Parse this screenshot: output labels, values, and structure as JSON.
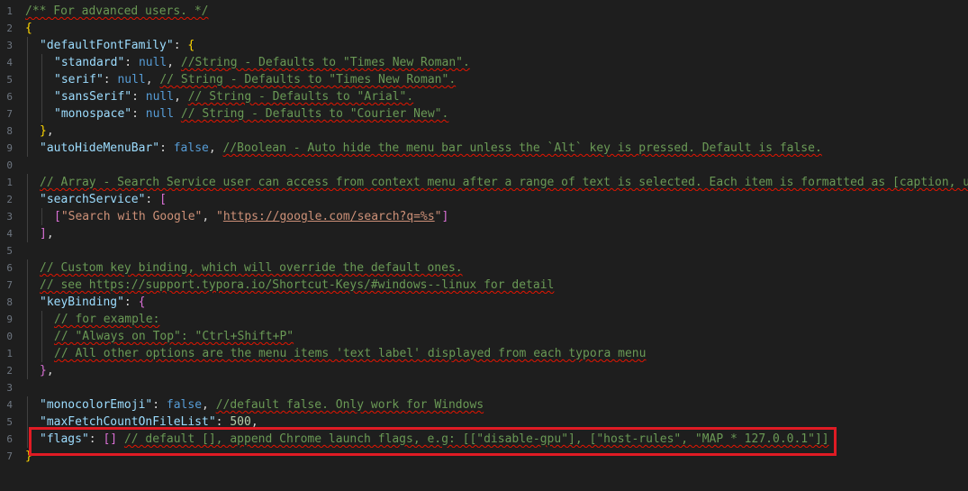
{
  "editor": {
    "line_numbers": [
      "1",
      "2",
      "3",
      "4",
      "5",
      "6",
      "7",
      "8",
      "9",
      "0",
      "1",
      "2",
      "3",
      "4",
      "5",
      "6",
      "7",
      "8",
      "9",
      "0",
      "1",
      "2",
      "3",
      "4",
      "5",
      "6",
      "7"
    ],
    "lines": [
      {
        "indent": 0,
        "tokens": [
          [
            "comment",
            "/** For advanced users. */",
            true
          ]
        ]
      },
      {
        "indent": 0,
        "tokens": [
          [
            "brace",
            "{"
          ]
        ]
      },
      {
        "indent": 1,
        "tokens": [
          [
            "key",
            "\"defaultFontFamily\""
          ],
          [
            "punc",
            ": "
          ],
          [
            "brace",
            "{"
          ]
        ]
      },
      {
        "indent": 2,
        "tokens": [
          [
            "key",
            "\"standard\""
          ],
          [
            "punc",
            ": "
          ],
          [
            "kw",
            "null"
          ],
          [
            "punc",
            ", "
          ],
          [
            "comment",
            "//String - Defaults to \"Times New Roman\".",
            true
          ]
        ]
      },
      {
        "indent": 2,
        "tokens": [
          [
            "key",
            "\"serif\""
          ],
          [
            "punc",
            ": "
          ],
          [
            "kw",
            "null"
          ],
          [
            "punc",
            ", "
          ],
          [
            "comment",
            "// String - Defaults to \"Times New Roman\".",
            true
          ]
        ]
      },
      {
        "indent": 2,
        "tokens": [
          [
            "key",
            "\"sansSerif\""
          ],
          [
            "punc",
            ": "
          ],
          [
            "kw",
            "null"
          ],
          [
            "punc",
            ", "
          ],
          [
            "comment",
            "// String - Defaults to \"Arial\".",
            true
          ]
        ]
      },
      {
        "indent": 2,
        "tokens": [
          [
            "key",
            "\"monospace\""
          ],
          [
            "punc",
            ": "
          ],
          [
            "kw",
            "null"
          ],
          [
            "punc",
            " "
          ],
          [
            "comment",
            "// String - Defaults to \"Courier New\".",
            true
          ]
        ]
      },
      {
        "indent": 1,
        "tokens": [
          [
            "brace",
            "}"
          ],
          [
            "punc",
            ","
          ]
        ]
      },
      {
        "indent": 1,
        "tokens": [
          [
            "key",
            "\"autoHideMenuBar\""
          ],
          [
            "punc",
            ": "
          ],
          [
            "kw",
            "false"
          ],
          [
            "punc",
            ", "
          ],
          [
            "comment",
            "//Boolean - Auto hide the menu bar unless the `Alt` key is pressed. Default is false.",
            true
          ]
        ]
      },
      {
        "indent": 0,
        "tokens": []
      },
      {
        "indent": 1,
        "tokens": [
          [
            "comment",
            "// Array - Search Service user can access from context menu after a range of text is selected. Each item is formatted as [caption, url]",
            true
          ]
        ]
      },
      {
        "indent": 1,
        "tokens": [
          [
            "key",
            "\"searchService\""
          ],
          [
            "punc",
            ": "
          ],
          [
            "bracket",
            "["
          ]
        ]
      },
      {
        "indent": 2,
        "tokens": [
          [
            "bracket",
            "["
          ],
          [
            "str",
            "\"Search with Google\""
          ],
          [
            "punc",
            ", "
          ],
          [
            "str",
            "\""
          ],
          [
            "link",
            "https://google.com/search?q=%s"
          ],
          [
            "str",
            "\""
          ],
          [
            "bracket",
            "]"
          ]
        ]
      },
      {
        "indent": 1,
        "tokens": [
          [
            "bracket",
            "]"
          ],
          [
            "punc",
            ","
          ]
        ]
      },
      {
        "indent": 0,
        "tokens": []
      },
      {
        "indent": 1,
        "tokens": [
          [
            "comment",
            "// Custom key binding, which will override the default ones.",
            true
          ]
        ]
      },
      {
        "indent": 1,
        "tokens": [
          [
            "comment",
            "// see https://support.typora.io/Shortcut-Keys/#windows--linux for detail",
            true
          ]
        ]
      },
      {
        "indent": 1,
        "tokens": [
          [
            "key",
            "\"keyBinding\""
          ],
          [
            "punc",
            ": "
          ],
          [
            "bracket",
            "{"
          ]
        ]
      },
      {
        "indent": 2,
        "tokens": [
          [
            "comment",
            "// for example:",
            true
          ]
        ]
      },
      {
        "indent": 2,
        "tokens": [
          [
            "comment",
            "// \"Always on Top\": \"Ctrl+Shift+P\"",
            true
          ]
        ]
      },
      {
        "indent": 2,
        "tokens": [
          [
            "comment",
            "// All other options are the menu items 'text label' displayed from each typora menu",
            true
          ]
        ]
      },
      {
        "indent": 1,
        "tokens": [
          [
            "bracket",
            "}"
          ],
          [
            "punc",
            ","
          ]
        ]
      },
      {
        "indent": 0,
        "tokens": []
      },
      {
        "indent": 1,
        "tokens": [
          [
            "key",
            "\"monocolorEmoji\""
          ],
          [
            "punc",
            ": "
          ],
          [
            "kw",
            "false"
          ],
          [
            "punc",
            ", "
          ],
          [
            "comment",
            "//default false. Only work for Windows",
            true
          ]
        ]
      },
      {
        "indent": 1,
        "tokens": [
          [
            "key",
            "\"maxFetchCountOnFileList\""
          ],
          [
            "punc",
            ": "
          ],
          [
            "num",
            "500"
          ],
          [
            "punc",
            ","
          ]
        ]
      },
      {
        "indent": 1,
        "tokens": [
          [
            "key",
            "\"flags\""
          ],
          [
            "punc",
            ": "
          ],
          [
            "bracket",
            "[]"
          ],
          [
            "punc",
            " "
          ],
          [
            "comment",
            "// default [], append Chrome launch flags, e.g: [[\"disable-gpu\"], [\"host-rules\", \"MAP * 127.0.0.1\"]]",
            true
          ]
        ]
      },
      {
        "indent": 0,
        "tokens": [
          [
            "brace",
            "}"
          ]
        ]
      }
    ]
  },
  "colors": {
    "background": "#1e1e1e",
    "highlight_box": "#e01b24",
    "squiggle": "#e51400"
  }
}
